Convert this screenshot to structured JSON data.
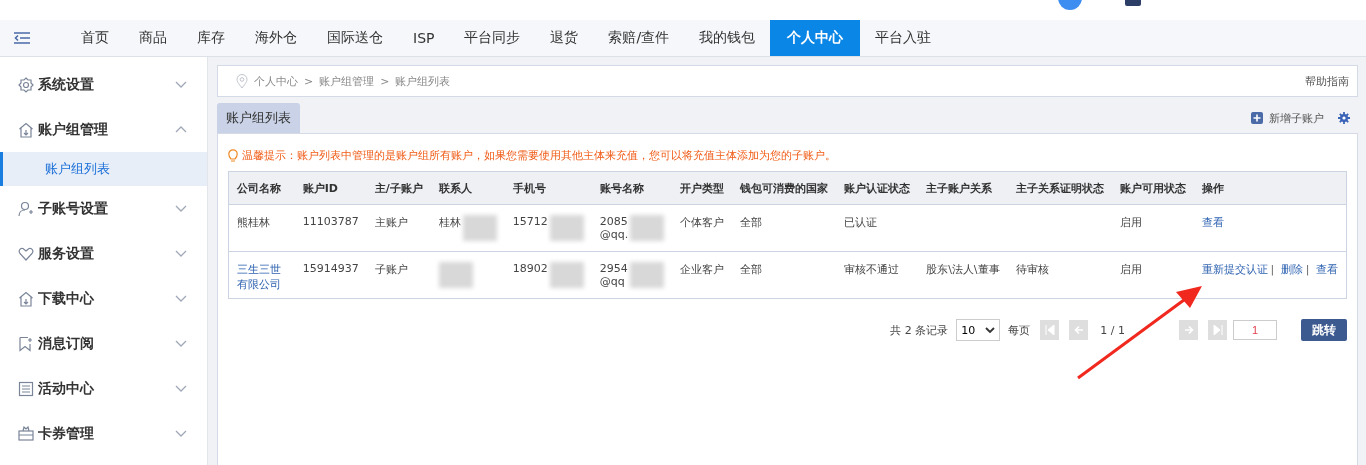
{
  "nav": {
    "tabs": [
      {
        "label": "首页",
        "selected": false
      },
      {
        "label": "商品",
        "selected": false
      },
      {
        "label": "库存",
        "selected": false
      },
      {
        "label": "海外仓",
        "selected": false
      },
      {
        "label": "国际送仓",
        "selected": false
      },
      {
        "label": "ISP",
        "selected": false
      },
      {
        "label": "平台同步",
        "selected": false
      },
      {
        "label": "退货",
        "selected": false
      },
      {
        "label": "索赔/查件",
        "selected": false
      },
      {
        "label": "我的钱包",
        "selected": false
      },
      {
        "label": "个人中心",
        "selected": true
      },
      {
        "label": "平台入驻",
        "selected": false
      }
    ]
  },
  "sidebar": {
    "items": [
      {
        "label": "系统设置",
        "expanded": false
      },
      {
        "label": "账户组管理",
        "expanded": true,
        "children": [
          {
            "label": "账户组列表",
            "selected": true
          }
        ]
      },
      {
        "label": "子账号设置",
        "expanded": false
      },
      {
        "label": "服务设置",
        "expanded": false
      },
      {
        "label": "下载中心",
        "expanded": false
      },
      {
        "label": "消息订阅",
        "expanded": false
      },
      {
        "label": "活动中心",
        "expanded": false
      },
      {
        "label": "卡券管理",
        "expanded": false
      }
    ]
  },
  "breadcrumb": {
    "items": [
      "个人中心",
      "账户组管理",
      "账户组列表"
    ],
    "separator": ">",
    "help_link": "帮助指南"
  },
  "panel": {
    "tab": "账户组列表",
    "add_button": "新增子账户",
    "tip": "温馨提示：账户列表中管理的是账户组所有账户，如果您需要使用其他主体来充值，您可以将充值主体添加为您的子账户。"
  },
  "table": {
    "action_separator": "|",
    "columns": [
      "公司名称",
      "账户ID",
      "主/子账户",
      "联系人",
      "手机号",
      "账号名称",
      "开户类型",
      "钱包可消费的国家",
      "账户认证状态",
      "主子账户关系",
      "主子关系证明状态",
      "账户可用状态",
      "操作"
    ],
    "rows": [
      {
        "cells": [
          {
            "text": "熊桂林",
            "link": false
          },
          {
            "text": "11103787"
          },
          {
            "text": "主账户"
          },
          {
            "text": "桂林",
            "blurred": true
          },
          {
            "text": "15712",
            "blurred": true
          },
          {
            "text": "2085\n@qq.",
            "blurred": true
          },
          {
            "text": "个体客户"
          },
          {
            "text": "全部"
          },
          {
            "text": "已认证"
          },
          {},
          {},
          {
            "text": "启用"
          }
        ],
        "actions": [
          "查看"
        ]
      },
      {
        "cells": [
          {
            "text": "三生三世有限公司",
            "link": true
          },
          {
            "text": "15914937"
          },
          {
            "text": "子账户"
          },
          {
            "blurred": true
          },
          {
            "text": "18902",
            "blurred": true
          },
          {
            "text": "2954\n@qq",
            "blurred": true
          },
          {
            "text": "企业客户"
          },
          {
            "text": "全部"
          },
          {
            "text": "审核不通过"
          },
          {
            "text": "股东\\法人\\董事"
          },
          {
            "text": "待审核"
          },
          {
            "text": "启用"
          }
        ],
        "actions": [
          "重新提交认证",
          "删除",
          "查看"
        ]
      }
    ]
  },
  "pagination": {
    "total": "共 2 条记录",
    "page_size": "10",
    "per_page_label": "每页",
    "page_info": "1 / 1",
    "page_input": "1",
    "jump_button": "跳转"
  }
}
